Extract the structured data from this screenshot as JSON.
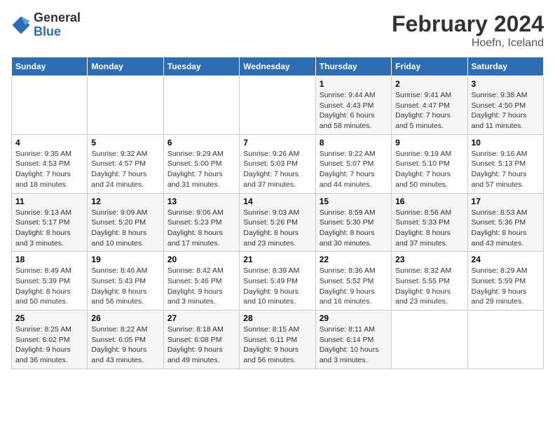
{
  "logo": {
    "general": "General",
    "blue": "Blue"
  },
  "title": "February 2024",
  "location": "Hoefn, Iceland",
  "days_of_week": [
    "Sunday",
    "Monday",
    "Tuesday",
    "Wednesday",
    "Thursday",
    "Friday",
    "Saturday"
  ],
  "weeks": [
    [
      {
        "day": "",
        "info": ""
      },
      {
        "day": "",
        "info": ""
      },
      {
        "day": "",
        "info": ""
      },
      {
        "day": "",
        "info": ""
      },
      {
        "day": "1",
        "info": "Sunrise: 9:44 AM\nSunset: 4:43 PM\nDaylight: 6 hours\nand 58 minutes."
      },
      {
        "day": "2",
        "info": "Sunrise: 9:41 AM\nSunset: 4:47 PM\nDaylight: 7 hours\nand 5 minutes."
      },
      {
        "day": "3",
        "info": "Sunrise: 9:38 AM\nSunset: 4:50 PM\nDaylight: 7 hours\nand 11 minutes."
      }
    ],
    [
      {
        "day": "4",
        "info": "Sunrise: 9:35 AM\nSunset: 4:53 PM\nDaylight: 7 hours\nand 18 minutes."
      },
      {
        "day": "5",
        "info": "Sunrise: 9:32 AM\nSunset: 4:57 PM\nDaylight: 7 hours\nand 24 minutes."
      },
      {
        "day": "6",
        "info": "Sunrise: 9:29 AM\nSunset: 5:00 PM\nDaylight: 7 hours\nand 31 minutes."
      },
      {
        "day": "7",
        "info": "Sunrise: 9:26 AM\nSunset: 5:03 PM\nDaylight: 7 hours\nand 37 minutes."
      },
      {
        "day": "8",
        "info": "Sunrise: 9:22 AM\nSunset: 5:07 PM\nDaylight: 7 hours\nand 44 minutes."
      },
      {
        "day": "9",
        "info": "Sunrise: 9:19 AM\nSunset: 5:10 PM\nDaylight: 7 hours\nand 50 minutes."
      },
      {
        "day": "10",
        "info": "Sunrise: 9:16 AM\nSunset: 5:13 PM\nDaylight: 7 hours\nand 57 minutes."
      }
    ],
    [
      {
        "day": "11",
        "info": "Sunrise: 9:13 AM\nSunset: 5:17 PM\nDaylight: 8 hours\nand 3 minutes."
      },
      {
        "day": "12",
        "info": "Sunrise: 9:09 AM\nSunset: 5:20 PM\nDaylight: 8 hours\nand 10 minutes."
      },
      {
        "day": "13",
        "info": "Sunrise: 9:06 AM\nSunset: 5:23 PM\nDaylight: 8 hours\nand 17 minutes."
      },
      {
        "day": "14",
        "info": "Sunrise: 9:03 AM\nSunset: 5:26 PM\nDaylight: 8 hours\nand 23 minutes."
      },
      {
        "day": "15",
        "info": "Sunrise: 8:59 AM\nSunset: 5:30 PM\nDaylight: 8 hours\nand 30 minutes."
      },
      {
        "day": "16",
        "info": "Sunrise: 8:56 AM\nSunset: 5:33 PM\nDaylight: 8 hours\nand 37 minutes."
      },
      {
        "day": "17",
        "info": "Sunrise: 8:53 AM\nSunset: 5:36 PM\nDaylight: 8 hours\nand 43 minutes."
      }
    ],
    [
      {
        "day": "18",
        "info": "Sunrise: 8:49 AM\nSunset: 5:39 PM\nDaylight: 8 hours\nand 50 minutes."
      },
      {
        "day": "19",
        "info": "Sunrise: 8:46 AM\nSunset: 5:43 PM\nDaylight: 8 hours\nand 56 minutes."
      },
      {
        "day": "20",
        "info": "Sunrise: 8:42 AM\nSunset: 5:46 PM\nDaylight: 9 hours\nand 3 minutes."
      },
      {
        "day": "21",
        "info": "Sunrise: 8:39 AM\nSunset: 5:49 PM\nDaylight: 9 hours\nand 10 minutes."
      },
      {
        "day": "22",
        "info": "Sunrise: 8:36 AM\nSunset: 5:52 PM\nDaylight: 9 hours\nand 16 minutes."
      },
      {
        "day": "23",
        "info": "Sunrise: 8:32 AM\nSunset: 5:55 PM\nDaylight: 9 hours\nand 23 minutes."
      },
      {
        "day": "24",
        "info": "Sunrise: 8:29 AM\nSunset: 5:59 PM\nDaylight: 9 hours\nand 29 minutes."
      }
    ],
    [
      {
        "day": "25",
        "info": "Sunrise: 8:25 AM\nSunset: 6:02 PM\nDaylight: 9 hours\nand 36 minutes."
      },
      {
        "day": "26",
        "info": "Sunrise: 8:22 AM\nSunset: 6:05 PM\nDaylight: 9 hours\nand 43 minutes."
      },
      {
        "day": "27",
        "info": "Sunrise: 8:18 AM\nSunset: 6:08 PM\nDaylight: 9 hours\nand 49 minutes."
      },
      {
        "day": "28",
        "info": "Sunrise: 8:15 AM\nSunset: 6:11 PM\nDaylight: 9 hours\nand 56 minutes."
      },
      {
        "day": "29",
        "info": "Sunrise: 8:11 AM\nSunset: 6:14 PM\nDaylight: 10 hours\nand 3 minutes."
      },
      {
        "day": "",
        "info": ""
      },
      {
        "day": "",
        "info": ""
      }
    ]
  ]
}
